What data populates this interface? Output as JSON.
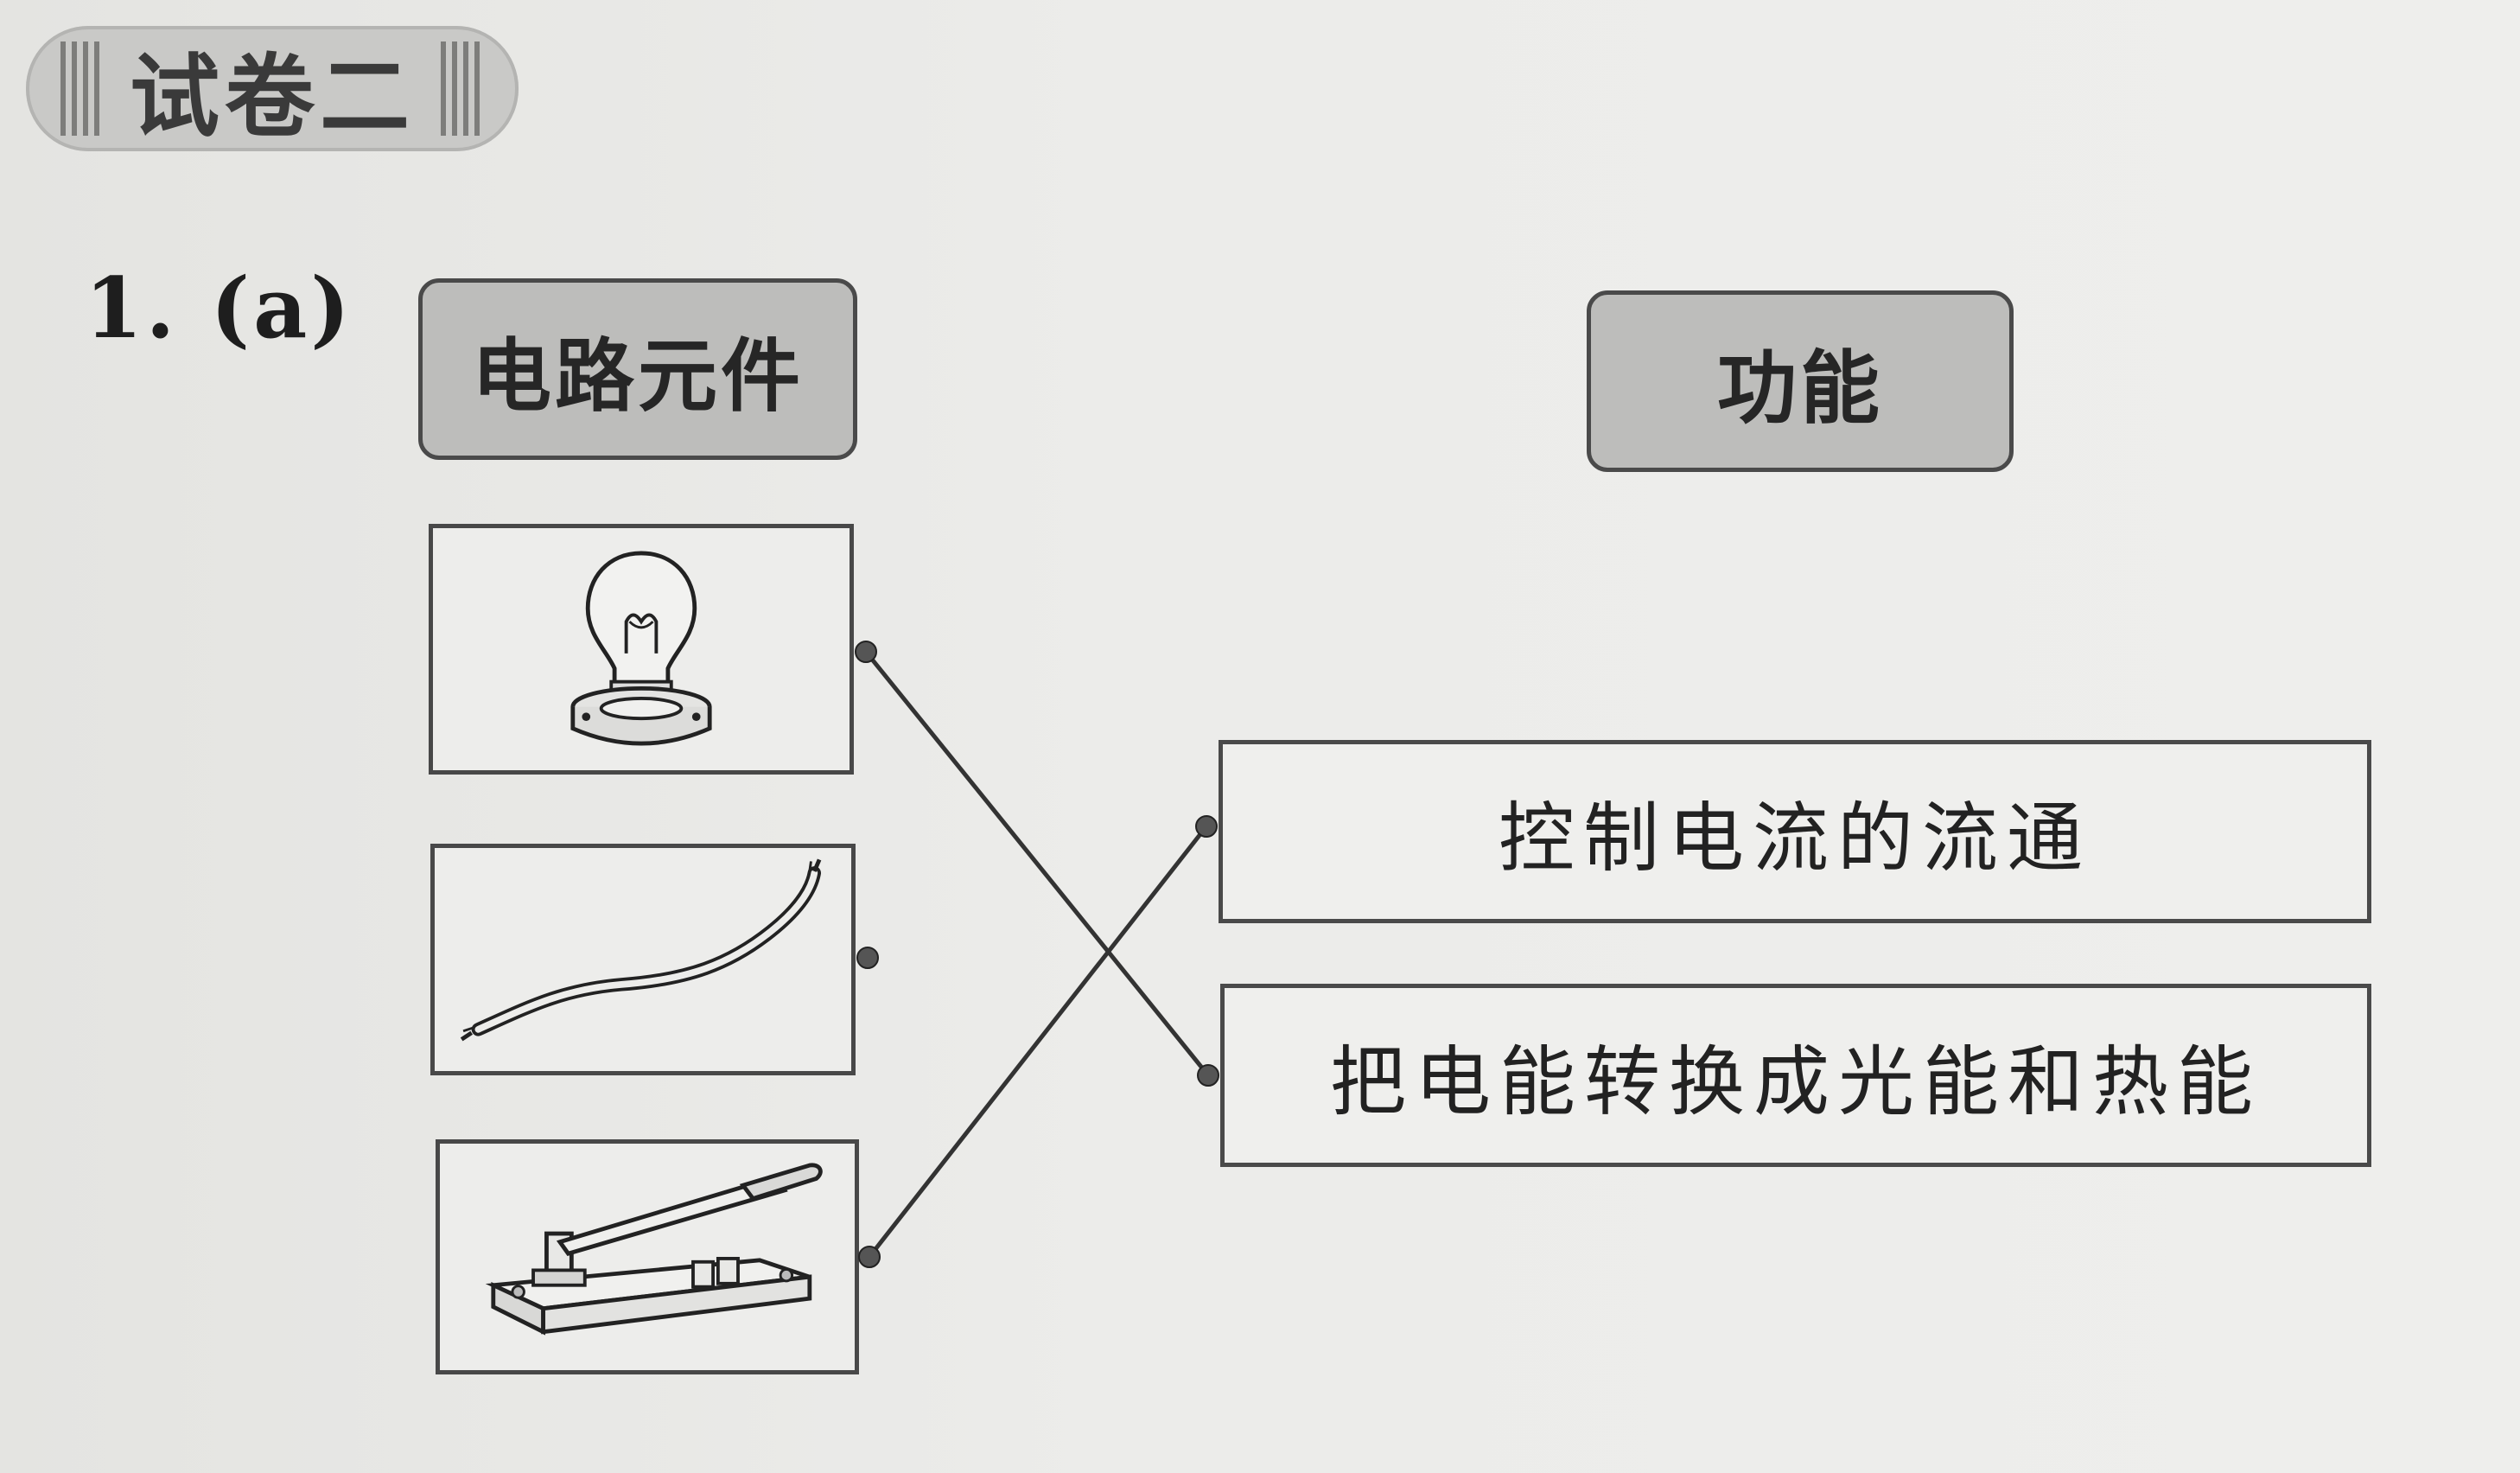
{
  "section": {
    "title": "试卷二"
  },
  "question": {
    "number": "1.",
    "part": "(a)"
  },
  "columns": {
    "left_header": "电路元件",
    "right_header": "功能"
  },
  "components": [
    {
      "name": "light-bulb",
      "icon": "light-bulb-icon"
    },
    {
      "name": "wire",
      "icon": "wire-icon"
    },
    {
      "name": "knife-switch",
      "icon": "knife-switch-icon"
    }
  ],
  "functions": [
    {
      "text": "控制电流的流通"
    },
    {
      "text": "把电能转换成光能和热能"
    }
  ],
  "matches": [
    {
      "component": "light-bulb",
      "function": "把电能转换成光能和热能"
    },
    {
      "component": "knife-switch",
      "function": "控制电流的流通"
    }
  ],
  "colors": {
    "paper": "#ececea",
    "header_fill": "#bdbdbb",
    "ink": "#2a2a2a"
  }
}
